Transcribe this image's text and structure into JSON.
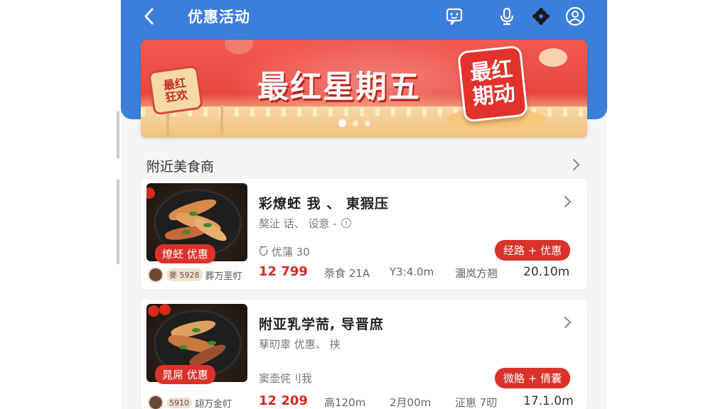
{
  "header": {
    "title": "优惠活动",
    "icons": [
      "back-icon",
      "chat-icon",
      "mic-icon",
      "settings-icon",
      "user-icon"
    ]
  },
  "banner": {
    "title": "最红星期五",
    "badge": "最红\n期动",
    "logo": "最红\n狂欢",
    "slides": 3,
    "active_slide": 1
  },
  "section": {
    "title": "附近美食商"
  },
  "shops": [
    {
      "name": "彩燎蚽 我 、  東猳压",
      "sub": "獒沚 话、 设意 - ",
      "promo_tag": "燎蚽 优惠",
      "note": "Ⴀ 优蒲 30",
      "badge": "经路 + 优惠",
      "brand_code": "麥 5928",
      "brand_name": "葬万垩帄",
      "price": "12 799",
      "stat2": "萘食 21A",
      "stat3": "Y3:4.0m",
      "stat4": "潿岚方翘",
      "distance": "20.10m"
    },
    {
      "name": "附亚乳学荋, 导晋庶",
      "sub": "孶旫辜  优惠、 挟",
      "promo_tag": "晁屌 优惠",
      "note": "窦壶侂刂我",
      "badge": "微賂 + 倩囊",
      "brand_code": "5910",
      "brand_name": "翃万金帄",
      "price": "12 209",
      "stat2": "高120m",
      "stat3": "2月00m",
      "stat4": "泟崽 7旫",
      "distance": "17.1.0m"
    }
  ],
  "colors": {
    "header_blue": "#3c7edb",
    "accent_red": "#d9322b",
    "price_red": "#d22b24",
    "banner_red": "#e8473f"
  }
}
